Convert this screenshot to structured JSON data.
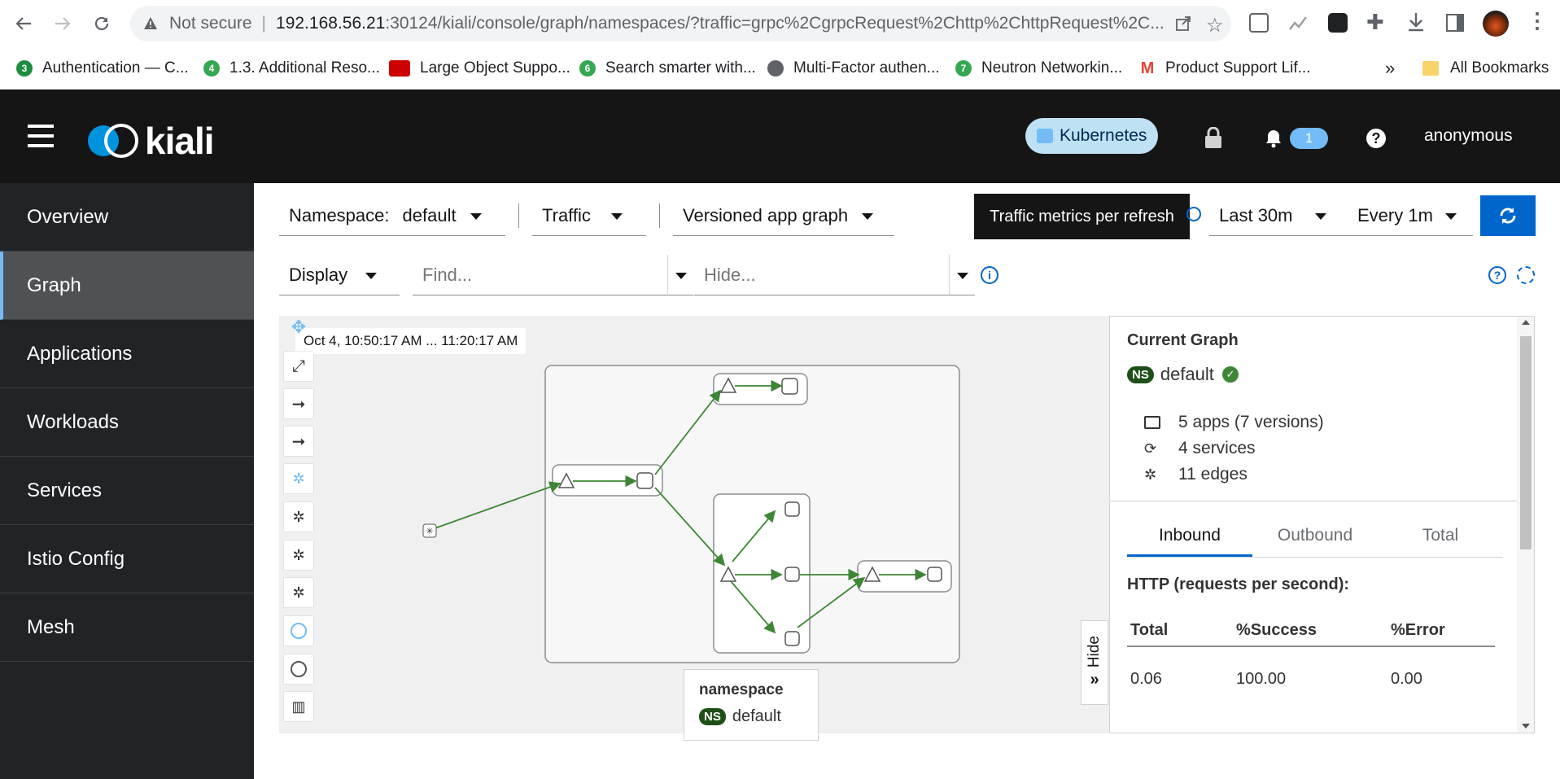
{
  "browser": {
    "security_label": "Not secure",
    "url_host": "192.168.56.21",
    "url_rest": ":30124/kiali/console/graph/namespaces/?traffic=grpc%2CgrpcRequest%2Chttp%2ChttpRequest%2C...",
    "bookmarks": [
      {
        "label": "Authentication — C...",
        "icon": "green-3-icon",
        "color": "#1e8e3e"
      },
      {
        "label": "1.3. Additional Reso...",
        "icon": "green-4-icon",
        "color": "#34a853"
      },
      {
        "label": "Large Object Suppo...",
        "icon": "redhat-icon",
        "color": "#cc0000"
      },
      {
        "label": "Search smarter with...",
        "icon": "green-6-icon",
        "color": "#34a853"
      },
      {
        "label": "Multi-Factor authen...",
        "icon": "globe-icon",
        "color": "#5f6368"
      },
      {
        "label": "Neutron Networkin...",
        "icon": "green-7-icon",
        "color": "#34a853"
      },
      {
        "label": "Product Support Lif...",
        "icon": "gmail-icon",
        "color": "#ea4335"
      }
    ],
    "overflow_label": "»",
    "all_bookmarks": "All Bookmarks"
  },
  "masthead": {
    "logo_text": "kiali",
    "cluster_badge": "Kubernetes",
    "notification_count": "1",
    "user": "anonymous"
  },
  "sidebar": {
    "items": [
      {
        "label": "Overview",
        "active": false
      },
      {
        "label": "Graph",
        "active": true
      },
      {
        "label": "Applications",
        "active": false
      },
      {
        "label": "Workloads",
        "active": false
      },
      {
        "label": "Services",
        "active": false
      },
      {
        "label": "Istio Config",
        "active": false
      },
      {
        "label": "Mesh",
        "active": false
      }
    ]
  },
  "toolbar": {
    "namespace_label": "Namespace:",
    "namespace_value": "default",
    "traffic": "Traffic",
    "graph_type": "Versioned app graph",
    "tooltip": "Traffic metrics per refresh",
    "duration": "Last 30m",
    "refresh": "Every 1m",
    "display": "Display",
    "find_placeholder": "Find...",
    "hide_placeholder": "Hide..."
  },
  "graph": {
    "timestamp": "Oct 4, 10:50:17 AM ... 11:20:17 AM",
    "hide_label": "Hide",
    "legend_title": "namespace",
    "legend_ns_badge": "NS",
    "legend_ns": "default"
  },
  "panel": {
    "title": "Current Graph",
    "ns_badge": "NS",
    "namespace": "default",
    "apps": "5 apps (7 versions)",
    "services": "4 services",
    "edges": "11 edges",
    "tabs": [
      "Inbound",
      "Outbound",
      "Total"
    ],
    "http_title": "HTTP (requests per second):",
    "columns": [
      "Total",
      "%Success",
      "%Error"
    ],
    "row": [
      "0.06",
      "100.00",
      "0.00"
    ]
  },
  "colors": {
    "accent": "#0066cc",
    "edge": "#3e8635",
    "ns_badge": "#1e4f18"
  }
}
